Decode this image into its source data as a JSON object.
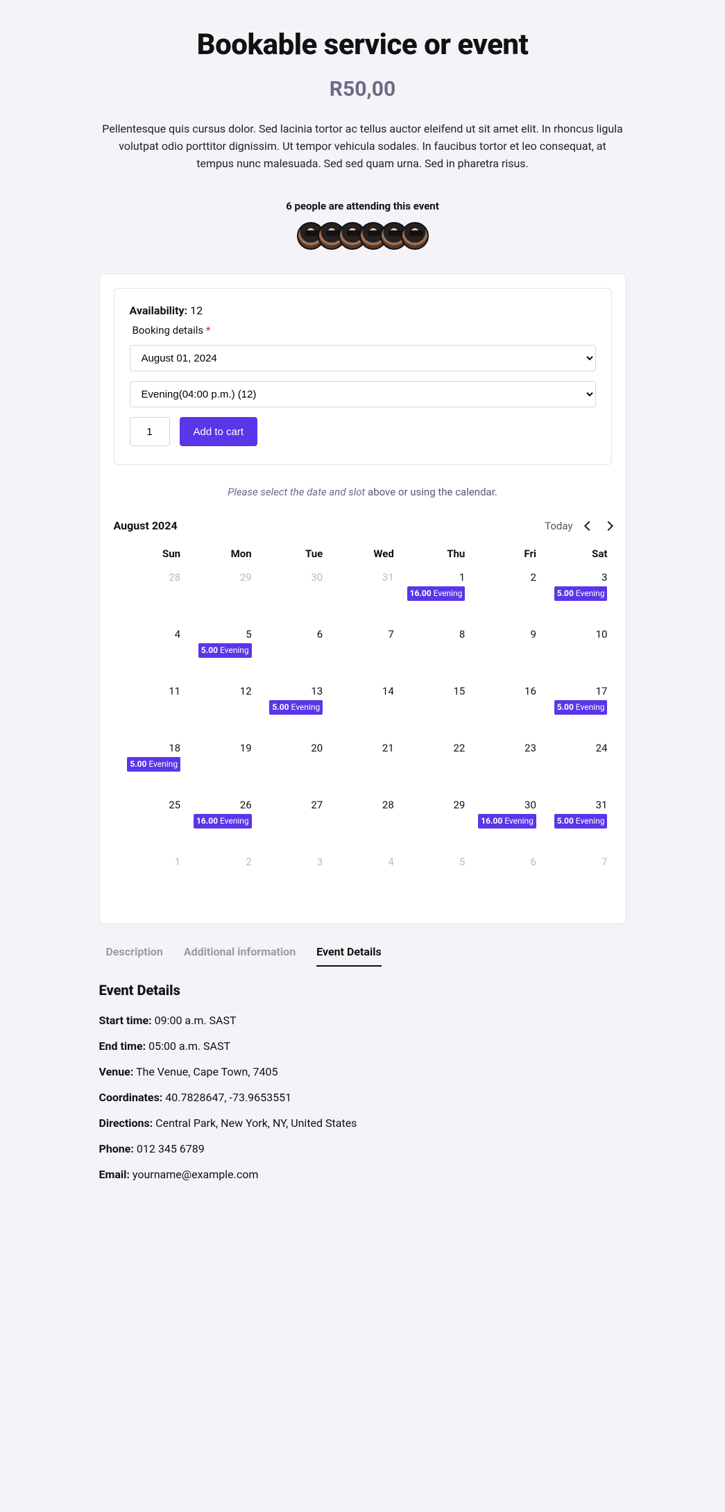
{
  "title": "Bookable service or event",
  "price": "R50,00",
  "description": "Pellentesque quis cursus dolor. Sed lacinia tortor ac tellus auctor eleifend ut sit amet elit. In rhoncus ligula volutpat odio porttitor dignissim. Ut tempor vehicula sodales. In faucibus tortor et leo consequat, at tempus nunc malesuada. Sed sed quam urna. Sed in pharetra risus.",
  "attendees_headline": "6 people are attending this event",
  "availability": {
    "label": "Availability:",
    "value": "12"
  },
  "booking_details_label": "Booking details",
  "required_star": "*",
  "date_select": {
    "value": "August 01, 2024"
  },
  "slot_select": {
    "value": "Evening(04:00 p.m.) (12)"
  },
  "quantity": "1",
  "add_to_cart_label": "Add to cart",
  "hint": {
    "em": "Please select the date and slot",
    "rest": " above or using the calendar."
  },
  "calendar": {
    "month_label": "August 2024",
    "today_label": "Today",
    "dow": [
      "Sun",
      "Mon",
      "Tue",
      "Wed",
      "Thu",
      "Fri",
      "Sat"
    ],
    "rows": [
      [
        {
          "num": "28",
          "outside": true
        },
        {
          "num": "29",
          "outside": true
        },
        {
          "num": "30",
          "outside": true
        },
        {
          "num": "31",
          "outside": true
        },
        {
          "num": "1",
          "events": [
            {
              "count": "16.00",
              "label": "Evening"
            }
          ]
        },
        {
          "num": "2"
        },
        {
          "num": "3",
          "events": [
            {
              "count": "5.00",
              "label": "Evening"
            }
          ]
        }
      ],
      [
        {
          "num": "4"
        },
        {
          "num": "5",
          "events": [
            {
              "count": "5.00",
              "label": "Evening"
            }
          ]
        },
        {
          "num": "6"
        },
        {
          "num": "7"
        },
        {
          "num": "8"
        },
        {
          "num": "9"
        },
        {
          "num": "10"
        }
      ],
      [
        {
          "num": "11"
        },
        {
          "num": "12"
        },
        {
          "num": "13",
          "events": [
            {
              "count": "5.00",
              "label": "Evening"
            }
          ]
        },
        {
          "num": "14"
        },
        {
          "num": "15"
        },
        {
          "num": "16"
        },
        {
          "num": "17",
          "events": [
            {
              "count": "5.00",
              "label": "Evening"
            }
          ]
        }
      ],
      [
        {
          "num": "18",
          "events": [
            {
              "count": "5.00",
              "label": "Evening"
            }
          ]
        },
        {
          "num": "19"
        },
        {
          "num": "20"
        },
        {
          "num": "21"
        },
        {
          "num": "22"
        },
        {
          "num": "23"
        },
        {
          "num": "24"
        }
      ],
      [
        {
          "num": "25"
        },
        {
          "num": "26",
          "events": [
            {
              "count": "16.00",
              "label": "Evening"
            }
          ]
        },
        {
          "num": "27"
        },
        {
          "num": "28"
        },
        {
          "num": "29"
        },
        {
          "num": "30",
          "events": [
            {
              "count": "16.00",
              "label": "Evening"
            }
          ]
        },
        {
          "num": "31",
          "events": [
            {
              "count": "5.00",
              "label": "Evening"
            }
          ]
        }
      ],
      [
        {
          "num": "1",
          "outside": true
        },
        {
          "num": "2",
          "outside": true
        },
        {
          "num": "3",
          "outside": true
        },
        {
          "num": "4",
          "outside": true
        },
        {
          "num": "5",
          "outside": true
        },
        {
          "num": "6",
          "outside": true
        },
        {
          "num": "7",
          "outside": true
        }
      ]
    ]
  },
  "tabs": {
    "description": "Description",
    "additional": "Additional information",
    "event_details": "Event Details"
  },
  "details": {
    "heading": "Event Details",
    "rows": [
      {
        "label": "Start time:",
        "value": "09:00 a.m. SAST"
      },
      {
        "label": "End time:",
        "value": "05:00 a.m. SAST"
      },
      {
        "label": "Venue:",
        "value": "The Venue, Cape Town, 7405"
      },
      {
        "label": "Coordinates:",
        "value": "40.7828647, -73.9653551"
      },
      {
        "label": "Directions:",
        "value": "Central Park, New York, NY, United States"
      },
      {
        "label": "Phone:",
        "value": "012 345 6789"
      },
      {
        "label": "Email:",
        "value": "yourname@example.com"
      }
    ]
  }
}
